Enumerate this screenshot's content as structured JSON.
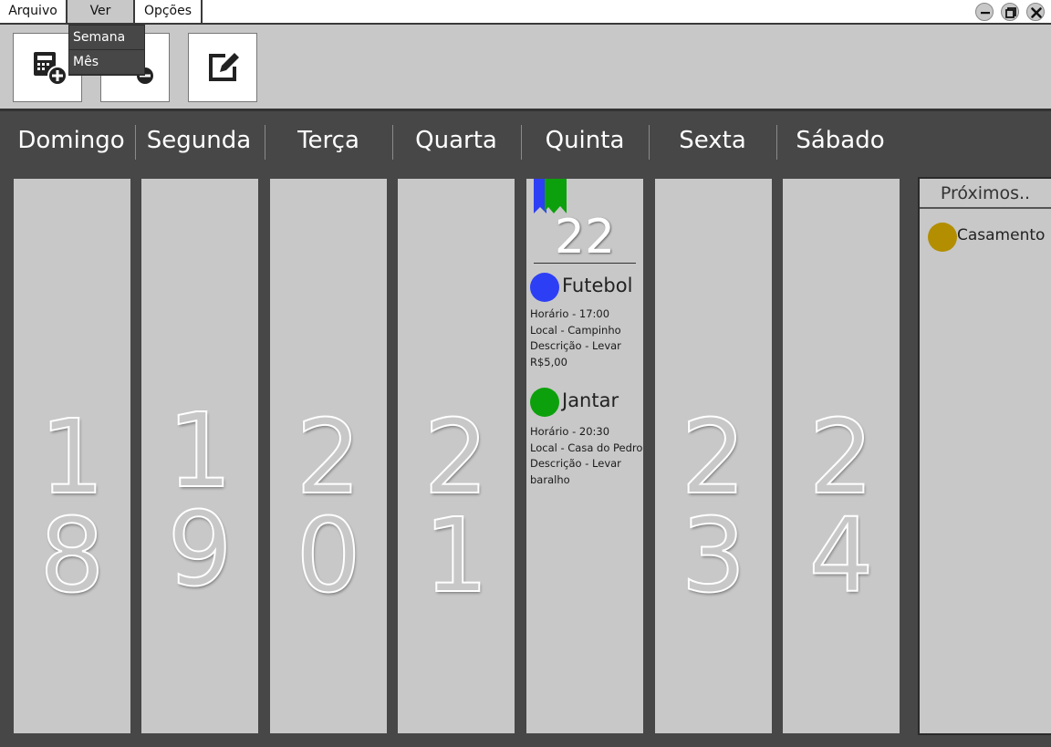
{
  "menu": {
    "items": [
      "Arquivo",
      "Ver",
      "Opções"
    ],
    "dropdown": [
      "Semana",
      "Mês"
    ]
  },
  "toolbar": {
    "buttons": [
      {
        "icon": "calendar-add-icon"
      },
      {
        "icon": "calendar-remove-icon"
      },
      {
        "icon": "edit-icon"
      }
    ]
  },
  "week": {
    "days": [
      "Domingo",
      "Segunda",
      "Terça",
      "Quarta",
      "Quinta",
      "Sexta",
      "Sábado"
    ],
    "dates": [
      {
        "d1": "1",
        "d2": "8"
      },
      {
        "d1": "1",
        "d2": "9"
      },
      {
        "d1": "2",
        "d2": "0"
      },
      {
        "d1": "2",
        "d2": "1"
      },
      {
        "d1": "",
        "d2": ""
      },
      {
        "d1": "2",
        "d2": "3"
      },
      {
        "d1": "2",
        "d2": "4"
      }
    ],
    "today": {
      "number": "22",
      "events": [
        {
          "title": "Futebol",
          "color": "#2d3ff5",
          "details": [
            "Horário - 17:00",
            "Local - Campinho",
            "Descrição - Levar",
            "R$5,00"
          ]
        },
        {
          "title": "Jantar",
          "color": "#0ca10c",
          "details": [
            "Horário - 20:30",
            "Local - Casa do Pedro",
            "Descrição - Levar",
            "baralho"
          ]
        }
      ]
    }
  },
  "upcoming": {
    "title": "Próximos..",
    "items": [
      {
        "label": "Casamento",
        "color": "#b28e00"
      }
    ]
  },
  "colors": {
    "bookmark_blue": "#2d3ff5",
    "bookmark_green": "#0ca10c"
  }
}
